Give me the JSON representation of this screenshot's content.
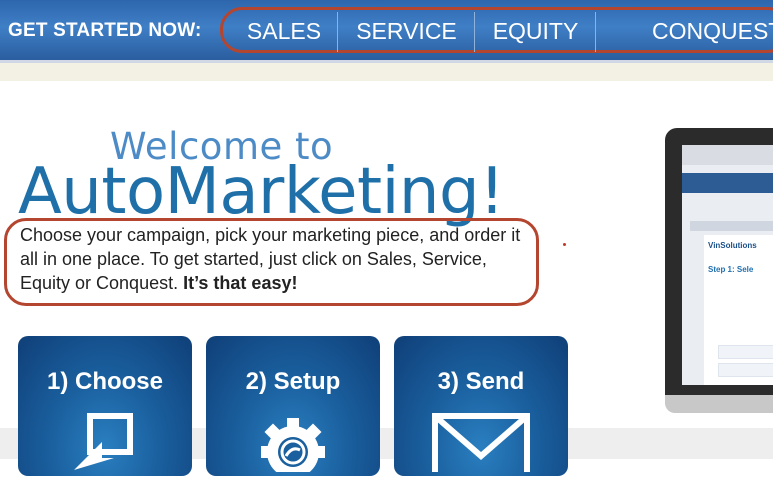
{
  "nav": {
    "title": "GET STARTED NOW:",
    "items": [
      {
        "label": "SALES"
      },
      {
        "label": "SERVICE"
      },
      {
        "label": "EQUITY"
      },
      {
        "label": "CONQUEST"
      }
    ]
  },
  "hero": {
    "welcome": "Welcome to",
    "brand": "AutoMarketing!",
    "intro": "Choose your campaign, pick your marketing piece, and order it all in one place. To get started, just click on Sales, Service, Equity or Conquest. ",
    "intro_bold": "It’s that easy!"
  },
  "cards": [
    {
      "label": "1) Choose",
      "icon": "cursor-select-icon"
    },
    {
      "label": "2) Setup",
      "icon": "gear-icon"
    },
    {
      "label": "3) Send",
      "icon": "envelope-icon"
    }
  ],
  "preview": {
    "brand": "VinSolutions",
    "step": "Step 1: Sele"
  },
  "colors": {
    "nav_blue": "#3f7fc6",
    "brand_blue": "#1f70a9",
    "highlight_red": "#b4452f",
    "card_blue": "#1a5f9e"
  }
}
